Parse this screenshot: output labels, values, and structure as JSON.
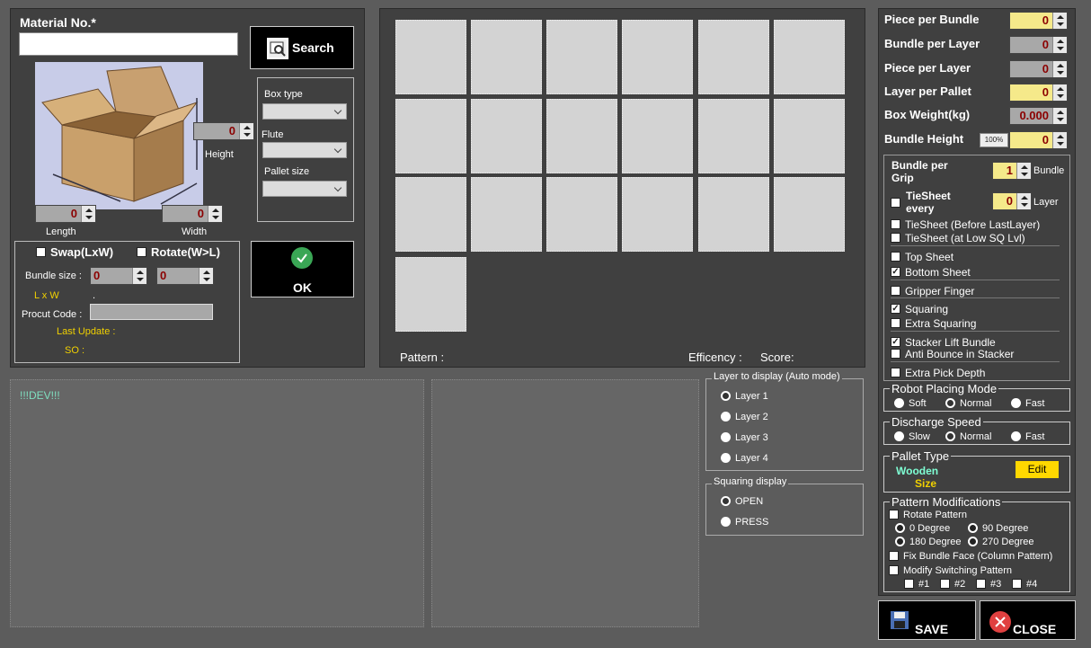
{
  "material": {
    "label": "Material No.*",
    "value": "",
    "search": "Search"
  },
  "box": {
    "height_label": "Height",
    "length_label": "Length",
    "width_label": "Width",
    "height": "0",
    "length": "0",
    "width": "0"
  },
  "combos": {
    "box_type": "Box type",
    "flute": "Flute",
    "pallet_size": "Pallet size"
  },
  "opts": {
    "swap": "Swap(LxW)",
    "rotate": "Rotate(W>L)",
    "bundle_size": "Bundle size :",
    "bs1": "0",
    "bs2": "0",
    "lxw": "L x W",
    "dot": ".",
    "product_code": "Procut Code :",
    "last_update": "Last Update :",
    "so": "SO :"
  },
  "ok": "OK",
  "pattern": {
    "pattern": "Pattern :",
    "efficiency": "Efficency :",
    "score": "Score:"
  },
  "dev": "!!!DEV!!!",
  "layer_display": {
    "title": "Layer to display (Auto mode)",
    "items": [
      "Layer 1",
      "Layer 2",
      "Layer 3",
      "Layer 4"
    ]
  },
  "squaring_display": {
    "title": "Squaring display",
    "items": [
      "OPEN",
      "PRESS"
    ]
  },
  "right": {
    "rows": [
      {
        "label": "Piece per Bundle",
        "value": "0"
      },
      {
        "label": "Bundle per Layer",
        "value": "0"
      },
      {
        "label": "Piece per Layer",
        "value": "0"
      },
      {
        "label": "Layer per Pallet",
        "value": "0"
      },
      {
        "label": "Box Weight(kg)",
        "value": "0.000"
      },
      {
        "label": "Bundle Height",
        "value": "0"
      }
    ],
    "pct": "100%",
    "bpg_label": "Bundle per Grip",
    "bpg_value": "1",
    "bpg_unit": "Bundle",
    "tie_label": "TieSheet every",
    "tie_value": "0",
    "tie_unit": "Layer",
    "checks": [
      "TieSheet (Before LastLayer)",
      "TieSheet (at Low SQ Lvl)",
      "Top Sheet",
      "Bottom Sheet",
      "Gripper Finger",
      "Squaring",
      "Extra Squaring",
      "Stacker Lift Bundle",
      "Anti Bounce in Stacker",
      "Extra Pick Depth"
    ],
    "robot": {
      "title": "Robot Placing Mode",
      "opts": [
        "Soft",
        "Normal",
        "Fast"
      ]
    },
    "discharge": {
      "title": "Discharge Speed",
      "opts": [
        "Slow",
        "Normal",
        "Fast"
      ]
    },
    "pallet": {
      "title": "Pallet Type",
      "type": "Wooden",
      "size": "Size",
      "edit": "Edit"
    },
    "pm": {
      "title": "Pattern Modifications",
      "rotate": "Rotate Pattern",
      "d0": "0 Degree",
      "d90": "90 Degree",
      "d180": "180 Degree",
      "d270": "270 Degree",
      "fix": "Fix Bundle Face (Column Pattern)",
      "modify": "Modify Switching Pattern",
      "n": [
        "#1",
        "#2",
        "#3",
        "#4"
      ]
    }
  },
  "save": "SAVE",
  "close": "CLOSE",
  "colors": {
    "yellow_text": "#f0d000",
    "edit_bg": "#ffd800",
    "wooden": "#7fffd4",
    "dev": "#7fe0c0"
  }
}
